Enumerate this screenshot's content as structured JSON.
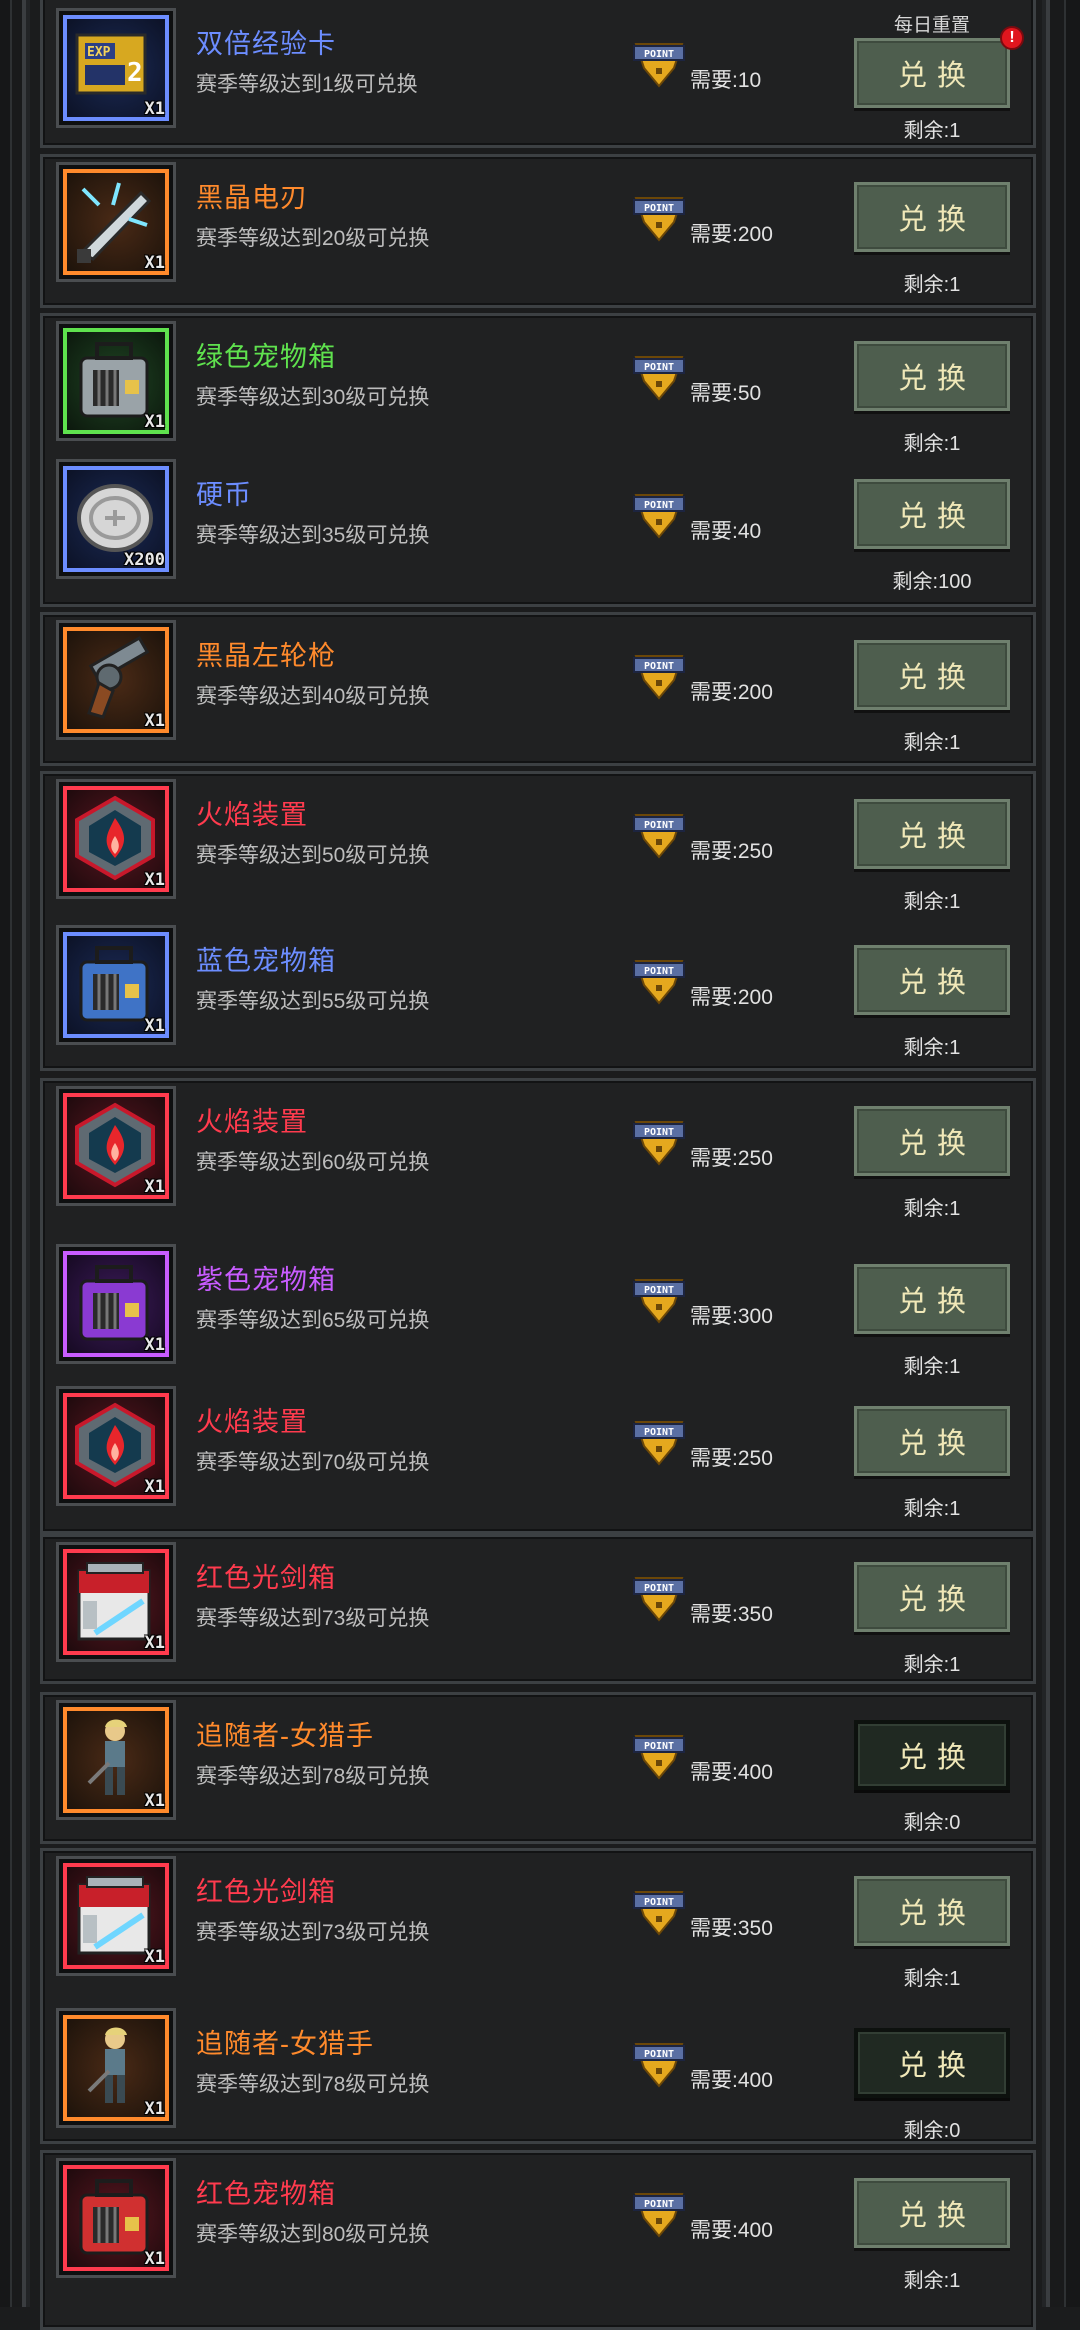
{
  "daily_reset_label": "每日重置",
  "notification_badge": "!",
  "colors": {
    "blue": "#6c8dff",
    "orange": "#ff8a2c",
    "green": "#5fe24e",
    "red": "#ff3b4e",
    "purple": "#c85cff",
    "requirement_text": "#bdbdbd",
    "button_fill": "#4e5e4e",
    "button_text": "#f0e8b8"
  },
  "items": [
    {
      "name": "双倍经验卡",
      "requirement": "赛季等级达到1级可兑换",
      "cost": "需要:10",
      "button": "兑换",
      "remaining": "剩余:1",
      "qty": "X1",
      "rarity": "blue",
      "icon": "exp-card-icon",
      "disabled": false
    },
    {
      "name": "黑晶电刃",
      "requirement": "赛季等级达到20级可兑换",
      "cost": "需要:200",
      "button": "兑换",
      "remaining": "剩余:1",
      "qty": "X1",
      "rarity": "orange",
      "icon": "electric-blade-icon",
      "disabled": false
    },
    {
      "name": "绿色宠物箱",
      "requirement": "赛季等级达到30级可兑换",
      "cost": "需要:50",
      "button": "兑换",
      "remaining": "剩余:1",
      "qty": "X1",
      "rarity": "green",
      "icon": "pet-crate-icon",
      "disabled": false
    },
    {
      "name": "硬币",
      "requirement": "赛季等级达到35级可兑换",
      "cost": "需要:40",
      "button": "兑换",
      "remaining": "剩余:100",
      "qty": "X200",
      "rarity": "blue",
      "icon": "coin-icon",
      "disabled": false
    },
    {
      "name": "黑晶左轮枪",
      "requirement": "赛季等级达到40级可兑换",
      "cost": "需要:200",
      "button": "兑换",
      "remaining": "剩余:1",
      "qty": "X1",
      "rarity": "orange",
      "icon": "revolver-icon",
      "disabled": false
    },
    {
      "name": "火焰装置",
      "requirement": "赛季等级达到50级可兑换",
      "cost": "需要:250",
      "button": "兑换",
      "remaining": "剩余:1",
      "qty": "X1",
      "rarity": "red",
      "icon": "flame-device-icon",
      "disabled": false
    },
    {
      "name": "蓝色宠物箱",
      "requirement": "赛季等级达到55级可兑换",
      "cost": "需要:200",
      "button": "兑换",
      "remaining": "剩余:1",
      "qty": "X1",
      "rarity": "blue",
      "icon": "pet-crate-icon",
      "disabled": false
    },
    {
      "name": "火焰装置",
      "requirement": "赛季等级达到60级可兑换",
      "cost": "需要:250",
      "button": "兑换",
      "remaining": "剩余:1",
      "qty": "X1",
      "rarity": "red",
      "icon": "flame-device-icon",
      "disabled": false
    },
    {
      "name": "紫色宠物箱",
      "requirement": "赛季等级达到65级可兑换",
      "cost": "需要:300",
      "button": "兑换",
      "remaining": "剩余:1",
      "qty": "X1",
      "rarity": "purple",
      "icon": "pet-crate-icon",
      "disabled": false
    },
    {
      "name": "火焰装置",
      "requirement": "赛季等级达到70级可兑换",
      "cost": "需要:250",
      "button": "兑换",
      "remaining": "剩余:1",
      "qty": "X1",
      "rarity": "red",
      "icon": "flame-device-icon",
      "disabled": false
    },
    {
      "name": "红色光剑箱",
      "requirement": "赛季等级达到73级可兑换",
      "cost": "需要:350",
      "button": "兑换",
      "remaining": "剩余:1",
      "qty": "X1",
      "rarity": "red",
      "icon": "saber-crate-icon",
      "disabled": false
    },
    {
      "name": "追随者-女猎手",
      "requirement": "赛季等级达到78级可兑换",
      "cost": "需要:400",
      "button": "兑换",
      "remaining": "剩余:0",
      "qty": "X1",
      "rarity": "orange",
      "icon": "huntress-icon",
      "disabled": true
    },
    {
      "name": "红色光剑箱",
      "requirement": "赛季等级达到73级可兑换",
      "cost": "需要:350",
      "button": "兑换",
      "remaining": "剩余:1",
      "qty": "X1",
      "rarity": "red",
      "icon": "saber-crate-icon",
      "disabled": false
    },
    {
      "name": "追随者-女猎手",
      "requirement": "赛季等级达到78级可兑换",
      "cost": "需要:400",
      "button": "兑换",
      "remaining": "剩余:0",
      "qty": "X1",
      "rarity": "orange",
      "icon": "huntress-icon",
      "disabled": true
    },
    {
      "name": "红色宠物箱",
      "requirement": "赛季等级达到80级可兑换",
      "cost": "需要:400",
      "button": "兑换",
      "remaining": "剩余:1",
      "qty": "X1",
      "rarity": "red",
      "icon": "pet-crate-icon",
      "disabled": false
    }
  ]
}
